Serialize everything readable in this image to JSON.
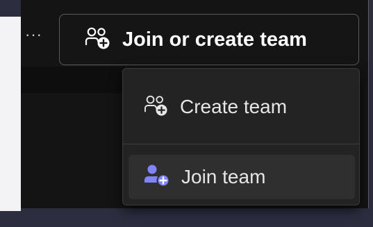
{
  "toolbar": {
    "more_glyph": "···",
    "join_create_label": "Join or create team"
  },
  "menu": {
    "items": [
      {
        "label": "Create team",
        "icon": "people-add-outline-icon"
      },
      {
        "label": "Join team",
        "icon": "people-add-filled-icon"
      }
    ]
  },
  "colors": {
    "accent": "#7f85f5",
    "text": "#ffffff",
    "menu_text": "#e6e6e6",
    "hover_background": "#2f2f2f"
  }
}
